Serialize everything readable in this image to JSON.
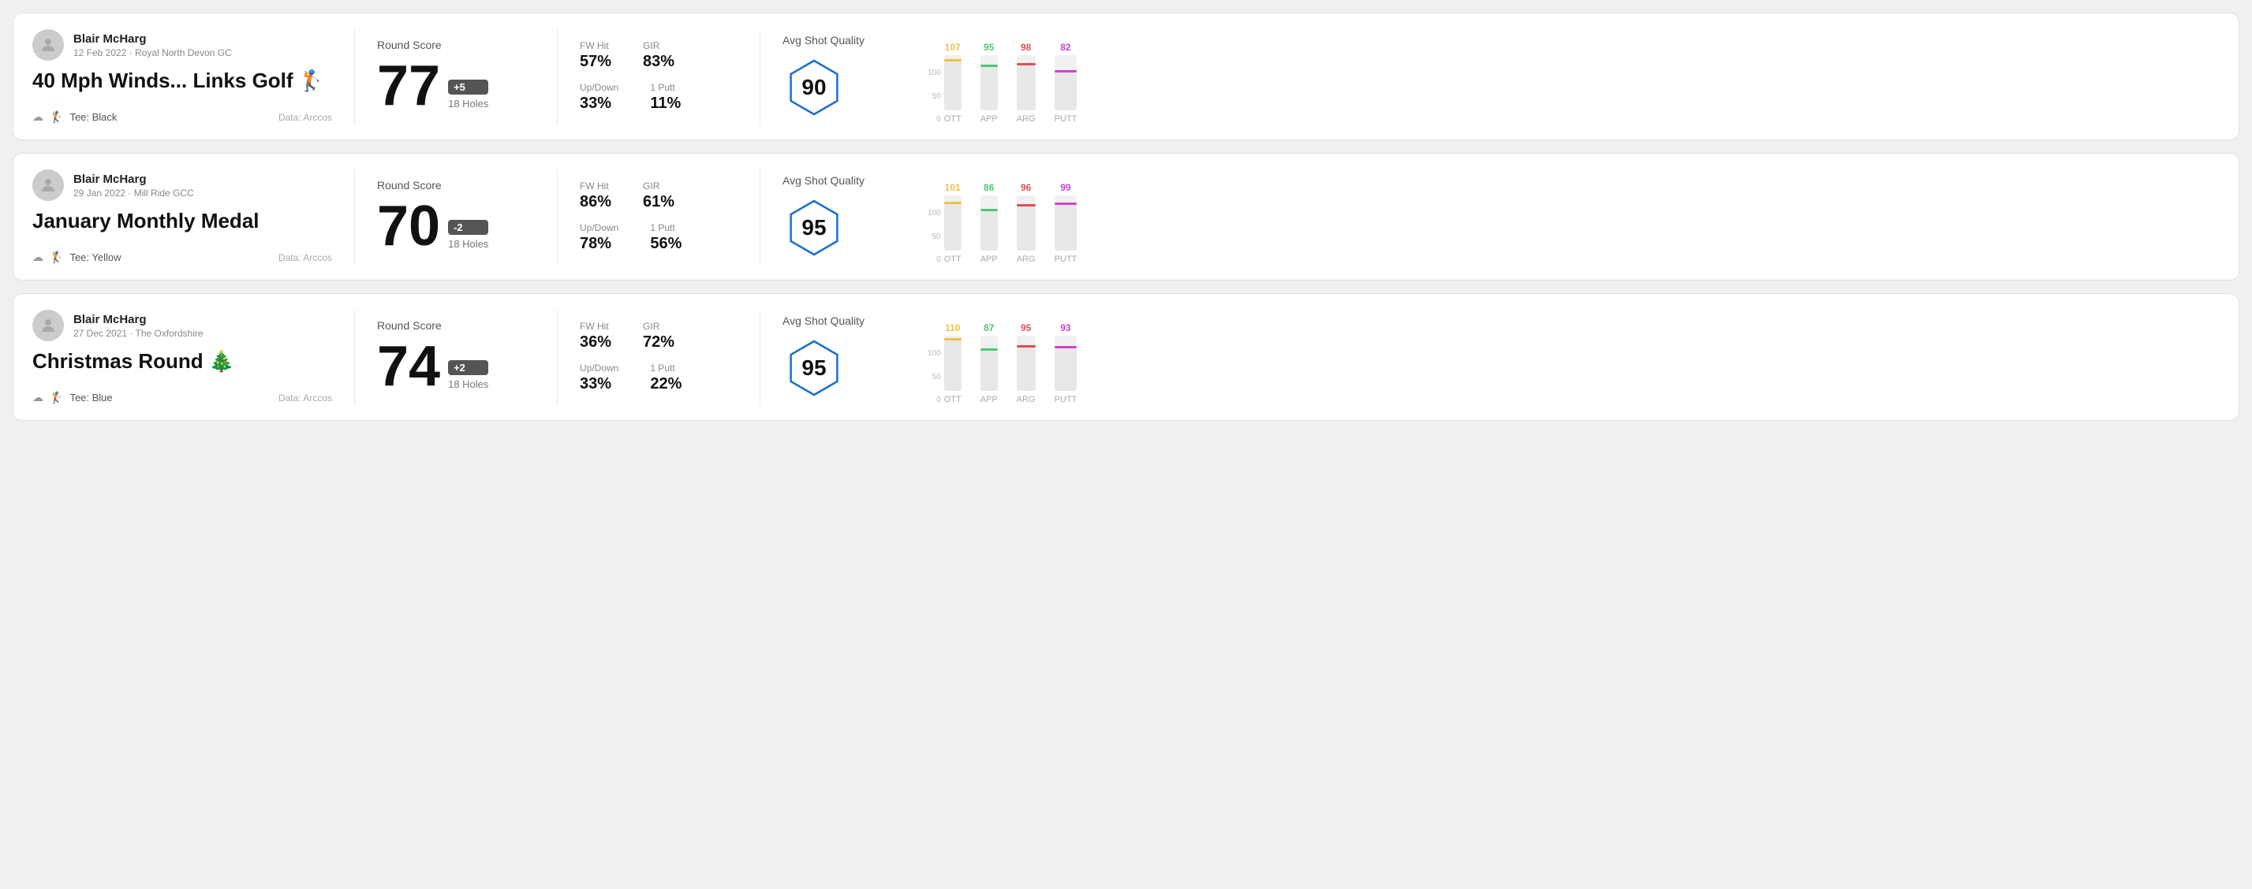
{
  "rounds": [
    {
      "id": "round-1",
      "player_name": "Blair McHarg",
      "date_course": "12 Feb 2022 · Royal North Devon GC",
      "title": "40 Mph Winds... Links Golf 🏌️",
      "tee": "Tee: Black",
      "data_source": "Data: Arccos",
      "round_score_label": "Round Score",
      "score": "77",
      "badge": "+5",
      "badge_type": "positive",
      "holes": "18 Holes",
      "fw_hit_label": "FW Hit",
      "fw_hit": "57%",
      "gir_label": "GIR",
      "gir": "83%",
      "updown_label": "Up/Down",
      "updown": "33%",
      "oneputt_label": "1 Putt",
      "oneputt": "11%",
      "quality_label": "Avg Shot Quality",
      "quality_score": "90",
      "bars": [
        {
          "label": "OTT",
          "value": 107,
          "color": "#f0c040"
        },
        {
          "label": "APP",
          "value": 95,
          "color": "#4fc870"
        },
        {
          "label": "ARG",
          "value": 98,
          "color": "#e05050"
        },
        {
          "label": "PUTT",
          "value": 82,
          "color": "#cc44cc"
        }
      ]
    },
    {
      "id": "round-2",
      "player_name": "Blair McHarg",
      "date_course": "29 Jan 2022 · Mill Ride GCC",
      "title": "January Monthly Medal",
      "tee": "Tee: Yellow",
      "data_source": "Data: Arccos",
      "round_score_label": "Round Score",
      "score": "70",
      "badge": "-2",
      "badge_type": "negative",
      "holes": "18 Holes",
      "fw_hit_label": "FW Hit",
      "fw_hit": "86%",
      "gir_label": "GIR",
      "gir": "61%",
      "updown_label": "Up/Down",
      "updown": "78%",
      "oneputt_label": "1 Putt",
      "oneputt": "56%",
      "quality_label": "Avg Shot Quality",
      "quality_score": "95",
      "bars": [
        {
          "label": "OTT",
          "value": 101,
          "color": "#f0c040"
        },
        {
          "label": "APP",
          "value": 86,
          "color": "#4fc870"
        },
        {
          "label": "ARG",
          "value": 96,
          "color": "#e05050"
        },
        {
          "label": "PUTT",
          "value": 99,
          "color": "#cc44cc"
        }
      ]
    },
    {
      "id": "round-3",
      "player_name": "Blair McHarg",
      "date_course": "27 Dec 2021 · The Oxfordshire",
      "title": "Christmas Round 🎄",
      "tee": "Tee: Blue",
      "data_source": "Data: Arccos",
      "round_score_label": "Round Score",
      "score": "74",
      "badge": "+2",
      "badge_type": "positive",
      "holes": "18 Holes",
      "fw_hit_label": "FW Hit",
      "fw_hit": "36%",
      "gir_label": "GIR",
      "gir": "72%",
      "updown_label": "Up/Down",
      "updown": "33%",
      "oneputt_label": "1 Putt",
      "oneputt": "22%",
      "quality_label": "Avg Shot Quality",
      "quality_score": "95",
      "bars": [
        {
          "label": "OTT",
          "value": 110,
          "color": "#f0c040"
        },
        {
          "label": "APP",
          "value": 87,
          "color": "#4fc870"
        },
        {
          "label": "ARG",
          "value": 95,
          "color": "#e05050"
        },
        {
          "label": "PUTT",
          "value": 93,
          "color": "#cc44cc"
        }
      ]
    }
  ],
  "y_axis": [
    "100",
    "50",
    "0"
  ]
}
